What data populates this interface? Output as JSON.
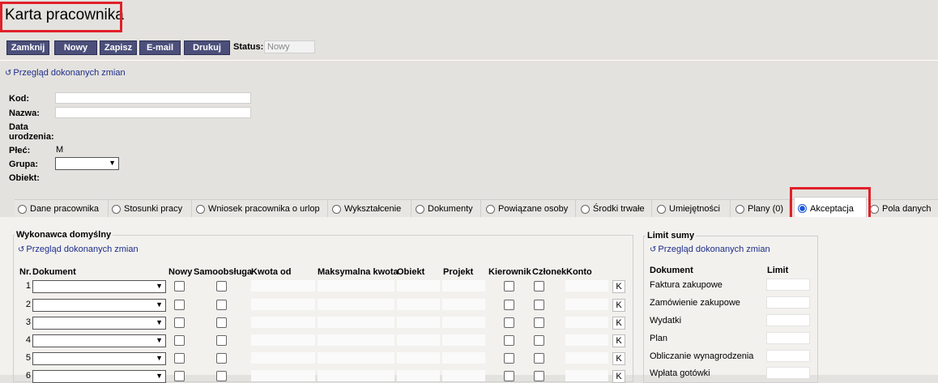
{
  "page_title": "Karta pracownika",
  "toolbar": {
    "buttons": [
      "Zamknij",
      "Nowy",
      "Zapisz",
      "E-mail",
      "Drukuj"
    ],
    "status_label": "Status:",
    "status_value": "Nowy"
  },
  "history_link": "Przegląd dokonanych zmian",
  "form": {
    "kod_label": "Kod:",
    "nazwa_label": "Nazwa:",
    "data_label_1": "Data",
    "data_label_2": "urodzenia:",
    "plec_label": "Płeć:",
    "plec_value": "M",
    "grupa_label": "Grupa:",
    "obiekt_label": "Obiekt:"
  },
  "tabs": [
    "Dane pracownika",
    "Stosunki pracy",
    "Wniosek pracownika o urlop",
    "Wykształcenie",
    "Dokumenty",
    "Powiązane osoby",
    "Środki trwałe",
    "Umiejętności",
    "Plany (0)",
    "Akceptacja",
    "Pola danych"
  ],
  "active_tab": "Akceptacja",
  "wykonawca": {
    "legend": "Wykonawca domyślny",
    "history_link": "Przegląd dokonanych zmian",
    "columns": [
      "Nr.",
      "Dokument",
      "Nowy",
      "Samoobsługa",
      "Kwota od",
      "Maksymalna kwota",
      "Obiekt",
      "Projekt",
      "Kierownik",
      "Członek",
      "Konto"
    ],
    "rows": [
      "1",
      "2",
      "3",
      "4",
      "5",
      "6"
    ],
    "k_label": "K"
  },
  "limit": {
    "legend": "Limit sumy",
    "history_link": "Przegląd dokonanych zmian",
    "col_document": "Dokument",
    "col_limit": "Limit",
    "rows": [
      "Faktura zakupowe",
      "Zamówienie zakupowe",
      "Wydatki",
      "Plan",
      "Obliczanie wynagrodzenia",
      "Wpłata gotówki"
    ]
  }
}
